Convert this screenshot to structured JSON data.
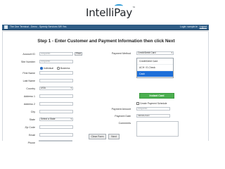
{
  "logo": {
    "text_main": "Intelli",
    "text_accent": "Pay",
    "tm": "™"
  },
  "topbar": {
    "title": "The One Terminal - Demo - Speedy Services SIR Yes",
    "user": "Login: sample.te",
    "logout": "Logout"
  },
  "step_title": "Step 1 - Enter Customer and Payment Information then click Next",
  "left_form": {
    "account_id": {
      "label": "Account ID",
      "placeholder": "Required",
      "button": "Find"
    },
    "site_number": {
      "label": "Site Number",
      "placeholder": "Required"
    },
    "customer_type": {
      "individual": "Individual",
      "business": "Business"
    },
    "first_name": {
      "label": "First Name"
    },
    "last_name": {
      "label": "Last Name"
    },
    "country": {
      "label": "Country",
      "value": "USA"
    },
    "address1": {
      "label": "Address 1"
    },
    "address2": {
      "label": "Address 2"
    },
    "city": {
      "label": "City"
    },
    "state": {
      "label": "State",
      "value": "Select a State"
    },
    "zip": {
      "label": "Zip Code"
    },
    "email": {
      "label": "Email"
    },
    "phone": {
      "label": "Phone"
    }
  },
  "right_form": {
    "payment_method": {
      "label": "Payment Method",
      "value": "Credit/Debit Card",
      "options": [
        "Credit/Debit Card",
        "ACH / E-Check",
        "Cash"
      ],
      "selected_option": "Cash"
    },
    "instant_card": "Instant Card",
    "schedule": {
      "label": "Create Payment Schedule"
    },
    "payment_amount": {
      "label": "Payment Amount",
      "placeholder": "Required"
    },
    "payment_date": {
      "label": "Payment Date",
      "value": "08/15/2020"
    },
    "comments": {
      "label": "Comments"
    }
  },
  "buttons": {
    "clear": "Clear Form",
    "next": "Next"
  },
  "colors": {
    "topbar": "#2f5d86",
    "accent": "#1e6fd9",
    "green": "#4caf50",
    "logo_accent": "#2e9ad6"
  }
}
